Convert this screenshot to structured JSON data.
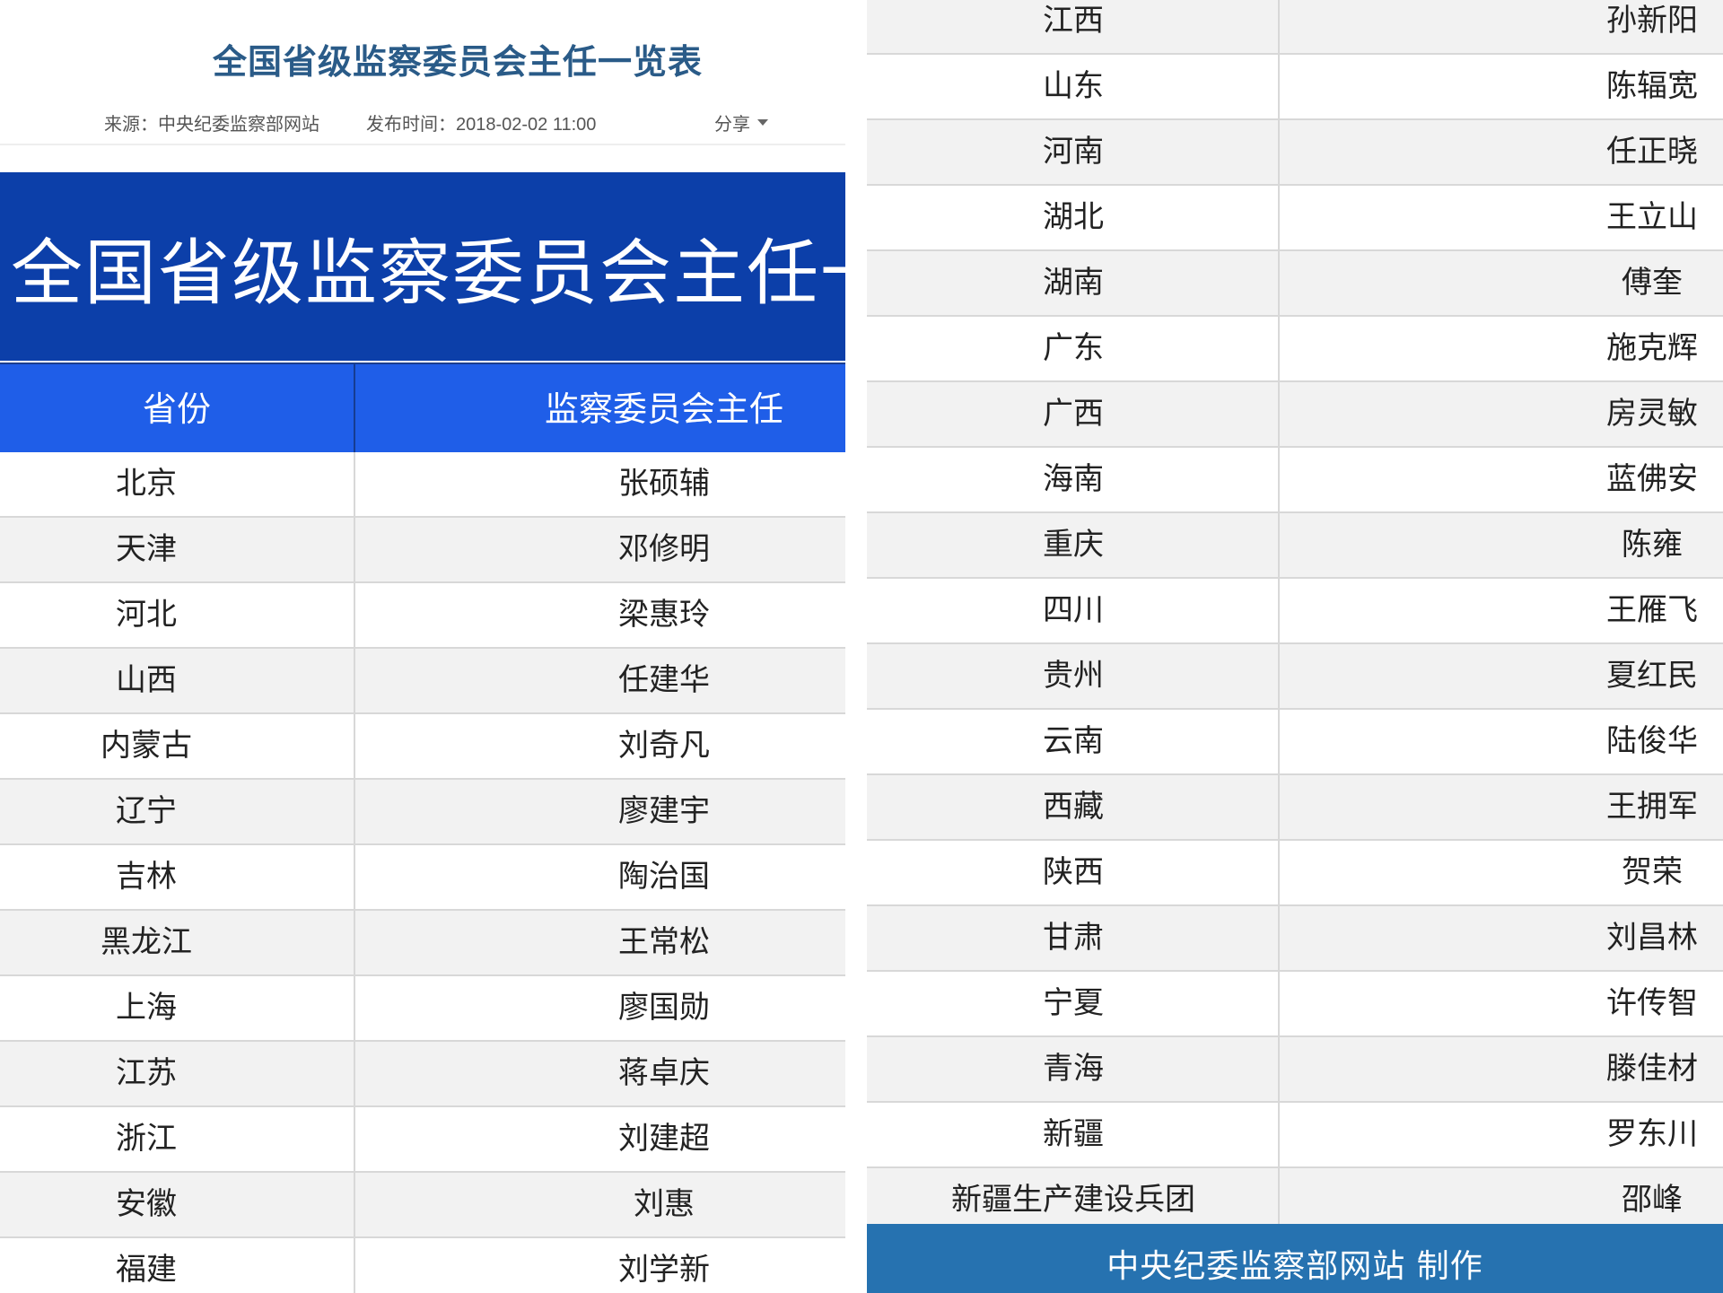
{
  "header": {
    "title": "全国省级监察委员会主任一览表",
    "source": "来源：中央纪委监察部网站",
    "published": "发布时间：2018-02-02 11:00",
    "share_label": "分享"
  },
  "banner": {
    "title": "全国省级监察委员会主任一览"
  },
  "table": {
    "columns": [
      "省份",
      "监察委员会主任"
    ],
    "rows_left": [
      {
        "province": "北京",
        "head": "张硕辅"
      },
      {
        "province": "天津",
        "head": "邓修明"
      },
      {
        "province": "河北",
        "head": "梁惠玲"
      },
      {
        "province": "山西",
        "head": "任建华"
      },
      {
        "province": "内蒙古",
        "head": "刘奇凡"
      },
      {
        "province": "辽宁",
        "head": "廖建宇"
      },
      {
        "province": "吉林",
        "head": "陶治国"
      },
      {
        "province": "黑龙江",
        "head": "王常松"
      },
      {
        "province": "上海",
        "head": "廖国勋"
      },
      {
        "province": "江苏",
        "head": "蒋卓庆"
      },
      {
        "province": "浙江",
        "head": "刘建超"
      },
      {
        "province": "安徽",
        "head": "刘惠"
      },
      {
        "province": "福建",
        "head": "刘学新"
      }
    ],
    "rows_right": [
      {
        "province": "江西",
        "head": "孙新阳"
      },
      {
        "province": "山东",
        "head": "陈辐宽"
      },
      {
        "province": "河南",
        "head": "任正晓"
      },
      {
        "province": "湖北",
        "head": "王立山"
      },
      {
        "province": "湖南",
        "head": "傅奎"
      },
      {
        "province": "广东",
        "head": "施克辉"
      },
      {
        "province": "广西",
        "head": "房灵敏"
      },
      {
        "province": "海南",
        "head": "蓝佛安"
      },
      {
        "province": "重庆",
        "head": "陈雍"
      },
      {
        "province": "四川",
        "head": "王雁飞"
      },
      {
        "province": "贵州",
        "head": "夏红民"
      },
      {
        "province": "云南",
        "head": "陆俊华"
      },
      {
        "province": "西藏",
        "head": "王拥军"
      },
      {
        "province": "陕西",
        "head": "贺荣"
      },
      {
        "province": "甘肃",
        "head": "刘昌林"
      },
      {
        "province": "宁夏",
        "head": "许传智"
      },
      {
        "province": "青海",
        "head": "滕佳材"
      },
      {
        "province": "新疆",
        "head": "罗东川"
      },
      {
        "province": "新疆生产建设兵团",
        "head": "邵峰"
      }
    ]
  },
  "footer": {
    "credit": "中央纪委监察部网站  制作"
  },
  "colors": {
    "banner_blue": "#0c3fa9",
    "header_blue": "#1f5ee8",
    "footer_blue": "#2672b0",
    "title_blue": "#2a5b88"
  }
}
